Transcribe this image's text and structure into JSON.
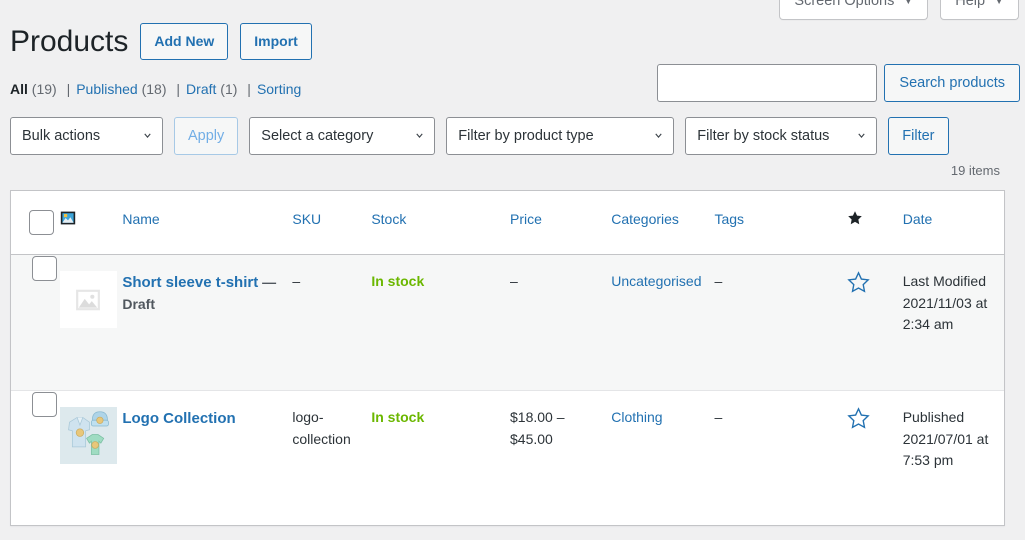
{
  "screen_meta": {
    "screen_options_label": "Screen Options",
    "help_label": "Help",
    "caret": "▼"
  },
  "header": {
    "title": "Products",
    "add_new_label": "Add New",
    "import_label": "Import"
  },
  "status_links": [
    {
      "label": "All",
      "count": "(19)",
      "current": true
    },
    {
      "label": "Published",
      "count": "(18)",
      "current": false
    },
    {
      "label": "Draft",
      "count": "(1)",
      "current": false
    },
    {
      "label": "Sorting",
      "count": "",
      "current": false
    }
  ],
  "separator": "|",
  "search": {
    "value": "",
    "placeholder": "",
    "submit_label": "Search products"
  },
  "filters": {
    "bulk_actions_label": "Bulk actions",
    "apply_label": "Apply",
    "apply_disabled": true,
    "category_label": "Select a category",
    "product_type_label": "Filter by product type",
    "stock_status_label": "Filter by stock status",
    "filter_label": "Filter"
  },
  "count_text": "19 items",
  "table": {
    "columns": [
      {
        "key": "cb",
        "label": "",
        "link": false,
        "icon": "checkbox-select-all"
      },
      {
        "key": "thumb",
        "label": "",
        "link": false,
        "icon": "image-icon"
      },
      {
        "key": "name",
        "label": "Name",
        "link": true
      },
      {
        "key": "sku",
        "label": "SKU",
        "link": true
      },
      {
        "key": "stock",
        "label": "Stock",
        "link": false
      },
      {
        "key": "price",
        "label": "Price",
        "link": true
      },
      {
        "key": "cat",
        "label": "Categories",
        "link": false
      },
      {
        "key": "tags",
        "label": "Tags",
        "link": false
      },
      {
        "key": "star",
        "label": "",
        "link": false,
        "icon": "featured-star-icon"
      },
      {
        "key": "date",
        "label": "Date",
        "link": true
      }
    ],
    "rows": [
      {
        "name": "Short sleeve t-shirt",
        "post_state": "— Draft",
        "thumb": "placeholder",
        "sku": "–",
        "stock": "In stock",
        "price": "–",
        "categories": "Uncategorised",
        "tags": "–",
        "featured": false,
        "date_status": "Last Modified",
        "date_value": "2021/11/03 at 2:34 am"
      },
      {
        "name": "Logo Collection",
        "post_state": "",
        "thumb": "logo-collection-photo",
        "sku": "logo-collection",
        "stock": "In stock",
        "price": "$18.00 – $45.00",
        "categories": "Clothing",
        "tags": "–",
        "featured": false,
        "date_status": "Published",
        "date_value": "2021/07/01 at 7:53 pm"
      }
    ]
  },
  "colors": {
    "link": "#2271b1",
    "in_stock": "#6bb700",
    "background": "#f0f0f1",
    "row_alt": "#f6f7f7",
    "text": "#3c434a"
  }
}
